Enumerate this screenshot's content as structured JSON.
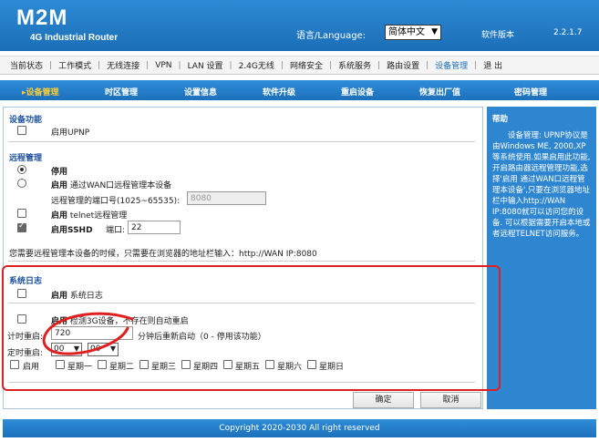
{
  "header": {
    "brand": "M2M",
    "subtitle": "4G Industrial Router",
    "language_label": "语言/Language:",
    "language_value": "简体中文",
    "version_label": "软件版本",
    "version_value": "2.2.1.7"
  },
  "topnav": [
    {
      "label": "当前状态"
    },
    {
      "label": "工作模式"
    },
    {
      "label": "无线连接"
    },
    {
      "label": "VPN"
    },
    {
      "label": "LAN 设置"
    },
    {
      "label": "2.4G无线"
    },
    {
      "label": "网络安全"
    },
    {
      "label": "系统服务"
    },
    {
      "label": "路由设置"
    },
    {
      "label": "设备管理",
      "active": true
    },
    {
      "label": "退 出"
    }
  ],
  "subnav": [
    {
      "label": "▸设备管理",
      "active": true
    },
    {
      "label": "时区管理"
    },
    {
      "label": "设置信息"
    },
    {
      "label": "软件升级"
    },
    {
      "label": "重启设备"
    },
    {
      "label": "恢复出厂值"
    },
    {
      "label": "密码管理"
    }
  ],
  "device_func": {
    "title": "设备功能",
    "upnp_label": "启用UPNP",
    "upnp_checked": false
  },
  "remote": {
    "title": "远程管理",
    "disable_label": "停用",
    "enable_bold": "启用",
    "enable_rest": " 通过WAN口远程管理本设备",
    "port_label": "远程管理的端口号(1025~65535):",
    "port_value": "8080",
    "telnet_bold": "启用",
    "telnet_rest": " telnet远程管理",
    "sshd_bold": "启用SSHD",
    "sshd_port_label": "端口:",
    "sshd_port_value": "22",
    "note": "您需要远程管理本设备的时候，只需要在浏览器的地址栏输入：http://WAN IP:8080"
  },
  "syslog": {
    "title": "系统日志",
    "enable_bold": "启用",
    "enable_rest": " 系统日志",
    "detect_bold": "启用",
    "detect_rest": " 检测3G设备，不存在则自动重启",
    "timer_label": "计时重启:",
    "timer_value": "720",
    "timer_suffix": "分钟后重新启动（0 - 停用该功能）",
    "sched_label": "定时重启:",
    "hour_value": "00",
    "minute_value": "00",
    "enable_label": "启用",
    "weekdays": [
      "星期一",
      "星期二",
      "星期三",
      "星期四",
      "星期五",
      "星期六",
      "星期日"
    ]
  },
  "buttons": {
    "ok": "确定",
    "cancel": "取消"
  },
  "help": {
    "title": "帮助",
    "text": "设备管理: UPNP协议是由Windows ME, 2000,XP等系统使用.如果启用此功能,开启路由器远程管理功能,选择'启用 通过WAN口远程管理本设备',只要在浏览器地址栏中输入http://WAN IP:8080就可以访问您的设备. 可以根据需要开启本地或者远程TELNET访问服务。"
  },
  "footer": {
    "copyright": "Copyright 2020-2030 All right reserved"
  },
  "colors": {
    "brand_blue": "#1b6fb8",
    "annotation_red": "#e02020",
    "active_subnav": "#ffcc33"
  }
}
